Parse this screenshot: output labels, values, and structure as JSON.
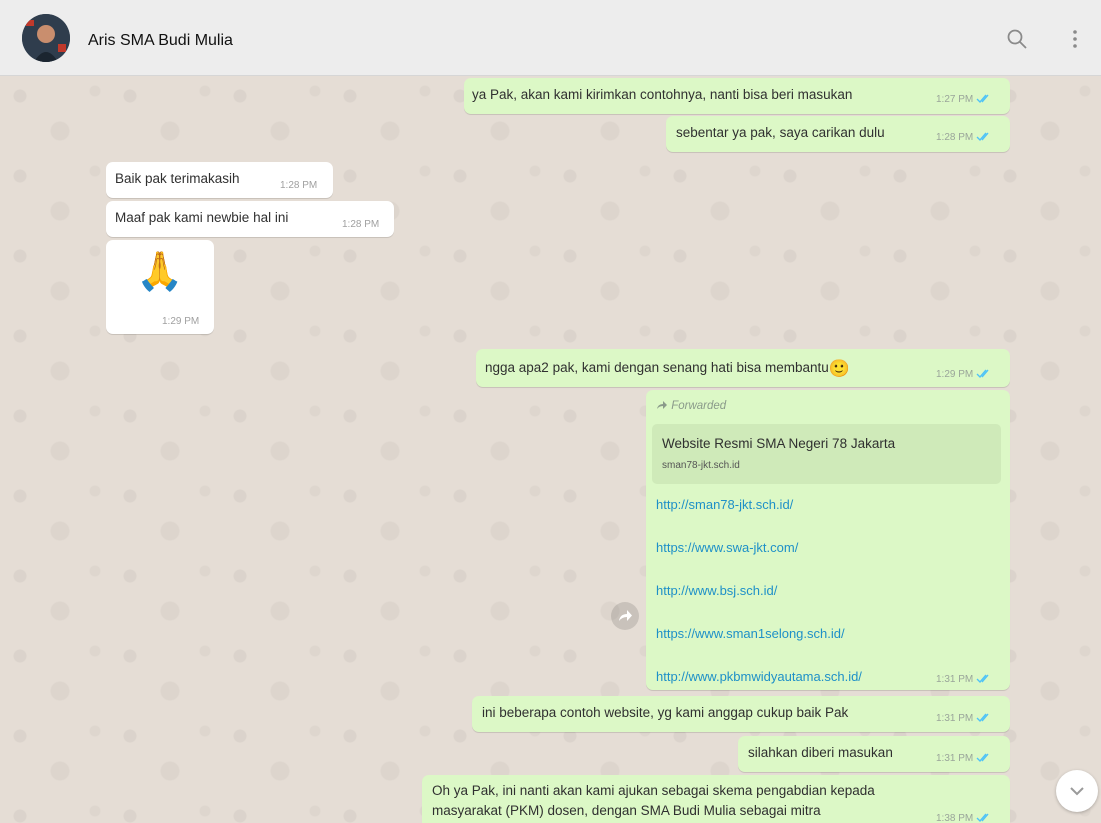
{
  "header": {
    "contact_name": "Aris SMA Budi Mulia",
    "avatar_icon": "contact-avatar",
    "search_icon": "search-icon",
    "menu_icon": "more-vert-icon"
  },
  "messages": [
    {
      "dir": "out",
      "text": "ya Pak, akan kami kirimkan contohnya, nanti bisa beri masukan",
      "time": "1:27 PM"
    },
    {
      "dir": "out",
      "text": "sebentar ya pak, saya carikan dulu",
      "time": "1:28 PM"
    },
    {
      "dir": "in",
      "text": "Baik pak terimakasih",
      "time": "1:28 PM"
    },
    {
      "dir": "in",
      "text": "Maaf pak kami newbie hal ini",
      "time": "1:28 PM"
    },
    {
      "dir": "in",
      "emoji": "🙏",
      "time": "1:29 PM"
    },
    {
      "dir": "out",
      "text": "ngga apa2 pak, kami dengan senang hati bisa membantu",
      "emoji": "🙂",
      "time": "1:29 PM"
    },
    {
      "dir": "out",
      "forwarded_label": "Forwarded",
      "preview_title": "Website Resmi SMA Negeri 78 Jakarta",
      "preview_domain": "sman78-jkt.sch.id",
      "links": [
        "http://sman78-jkt.sch.id/",
        "https://www.swa-jkt.com/",
        "http://www.bsj.sch.id/",
        "https://www.sman1selong.sch.id/",
        "http://www.pkbmwidyautama.sch.id/"
      ],
      "time": "1:31 PM"
    },
    {
      "dir": "out",
      "text": "ini beberapa contoh website, yg kami anggap cukup baik Pak",
      "time": "1:31 PM"
    },
    {
      "dir": "out",
      "text": "silahkan diberi masukan",
      "time": "1:31 PM"
    },
    {
      "dir": "out",
      "text_lines": [
        "Oh ya Pak, ini nanti akan kami ajukan sebagai skema pengabdian kepada",
        "masyarakat (PKM) dosen, dengan SMA Budi Mulia sebagai mitra"
      ],
      "time": "1:38 PM"
    }
  ],
  "colors": {
    "outgoing_bubble": "#dcf8c6",
    "incoming_bubble": "#ffffff",
    "read_tick": "#4fc3f7",
    "link": "#1e90c8"
  },
  "controls": {
    "forward_icon": "share-icon",
    "scroll_down_icon": "chevron-down-icon"
  }
}
